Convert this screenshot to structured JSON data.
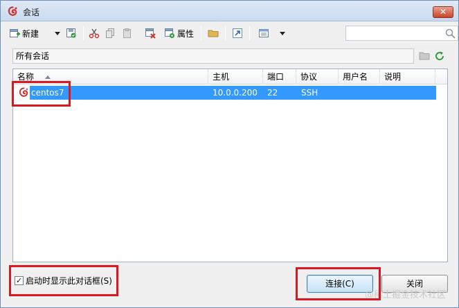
{
  "window": {
    "title": "会话",
    "close_glyph": "✕"
  },
  "toolbar": {
    "new_label": "新建",
    "properties_label": "属性",
    "search_placeholder": ""
  },
  "path_bar": {
    "text": "所有会话"
  },
  "table": {
    "columns": [
      "名称",
      "主机",
      "端口",
      "协议",
      "用户名",
      "说明"
    ],
    "rows": [
      {
        "name": "centos7",
        "host": "10.0.0.200",
        "port": "22",
        "protocol": "SSH",
        "user": "",
        "note": ""
      }
    ]
  },
  "footer": {
    "startup_checkbox_label": "启动时显示此对话框(S)",
    "startup_checked": true,
    "check_glyph": "✓",
    "connect_label": "连接(C)",
    "close_label": "关闭"
  },
  "watermark": "@稀土掘金技术社区",
  "colors": {
    "selection": "#3399ff",
    "highlight_box": "#e0161e",
    "accent_green": "#2e9c3a"
  }
}
